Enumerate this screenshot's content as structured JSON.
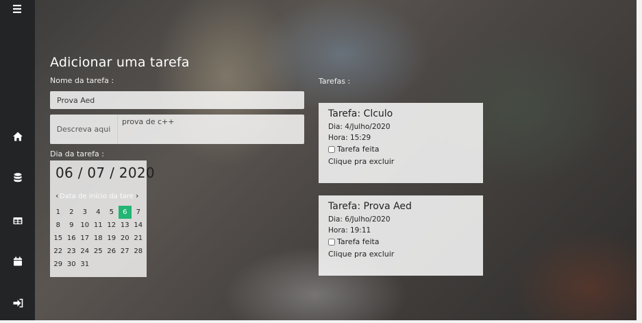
{
  "sidebar": {
    "icons": [
      "menu-icon",
      "home-icon",
      "database-icon",
      "table-icon",
      "calendar-icon",
      "sign-out-icon"
    ]
  },
  "form": {
    "title": "Adicionar uma tarefa",
    "name_label": "Nome da tarefa :",
    "name_value": "Prova Aed",
    "desc_addon": "Descreva aqui",
    "desc_value": "prova de c++",
    "date_label": "Dia da tarefa :"
  },
  "datepicker": {
    "display": "06 / 07 / 2020",
    "prev": "‹",
    "next": "›",
    "hint": "Data de início da tarefa",
    "selected_day": "6",
    "weeks": [
      [
        "1",
        "2",
        "3",
        "4",
        "5",
        "6",
        "7"
      ],
      [
        "8",
        "9",
        "10",
        "11",
        "12",
        "13",
        "14"
      ],
      [
        "15",
        "16",
        "17",
        "18",
        "19",
        "20",
        "21"
      ],
      [
        "22",
        "23",
        "24",
        "25",
        "26",
        "27",
        "28"
      ],
      [
        "29",
        "30",
        "31"
      ]
    ]
  },
  "tasks": {
    "label": "Tarefas :",
    "items": [
      {
        "title": "Tarefa: Clculo",
        "date": "Dia: 4/Julho/2020",
        "time": "Hora: 15:29",
        "done_label": "Tarefa feita",
        "delete_label": "Clique pra excluir"
      },
      {
        "title": "Tarefa: Prova Aed",
        "date": "Dia: 6/Julho/2020",
        "time": "Hora: 19:11",
        "done_label": "Tarefa feita",
        "delete_label": "Clique pra excluir"
      }
    ]
  },
  "colors": {
    "sidebar_bg": "#232426",
    "selected_day": "#22b573"
  }
}
